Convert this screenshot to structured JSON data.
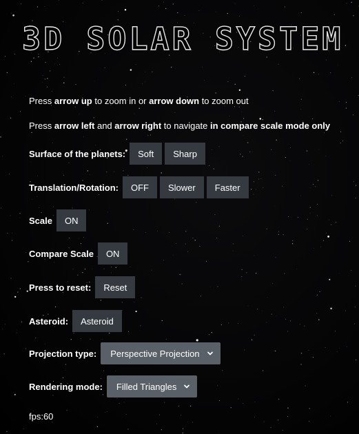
{
  "title": "3D SOLAR SYSTEM",
  "instructions": {
    "line1": {
      "p1": "Press ",
      "b1": "arrow up",
      "p2": " to zoom in or ",
      "b2": "arrow down",
      "p3": " to zoom out"
    },
    "line2": {
      "p1": "Press ",
      "b1": "arrow left",
      "p2": " and ",
      "b2": "arrow right",
      "p3": " to navigate ",
      "b3": "in compare scale mode only"
    }
  },
  "controls": {
    "surface": {
      "label": "Surface of the planets:",
      "soft": "Soft",
      "sharp": "Sharp"
    },
    "translation": {
      "label": "Translation/Rotation:",
      "off": "OFF",
      "slower": "Slower",
      "faster": "Faster"
    },
    "scale": {
      "label": "Scale",
      "button": "ON"
    },
    "compare": {
      "label": "Compare Scale",
      "button": "ON"
    },
    "reset": {
      "label": "Press to reset:",
      "button": "Reset"
    },
    "asteroid": {
      "label": "Asteroid:",
      "button": "Asteroid"
    },
    "projection": {
      "label": "Projection type:",
      "selected": "Perspective Projection"
    },
    "rendering": {
      "label": "Rendering mode:",
      "selected": "Filled Triangles"
    }
  },
  "fps": "fps:60",
  "colors": {
    "background": "#000000",
    "button": "#343a40",
    "select": "#596067",
    "text": "#ffffff"
  },
  "icons": {
    "select_arrow": "chevron-down-icon"
  }
}
